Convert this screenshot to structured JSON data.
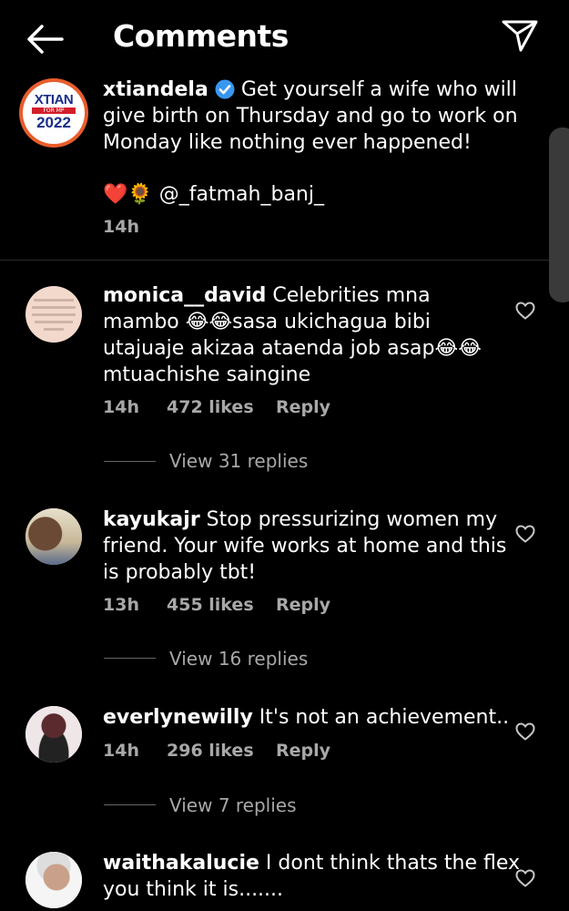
{
  "header": {
    "title": "Comments",
    "back_icon": "back-arrow-icon",
    "send_icon": "send-icon"
  },
  "caption": {
    "username": "xtiandela",
    "verified": true,
    "text_line1": "Get yourself a wife who will",
    "text_line2": "give birth on Thursday and go to work on",
    "text_line3": "Monday like nothing ever happened!",
    "emoji_line": "❤️🌻 @_fatmah_banj_",
    "time": "14h",
    "avatar_text_top": "XTIAN",
    "avatar_text_mid": "FOR MP",
    "avatar_text_bottom": "2022",
    "colors": {
      "ring": "#e85d2c",
      "blue": "#1a2f8a",
      "red": "#d21f2b",
      "verified": "#3897f0"
    }
  },
  "comments": [
    {
      "username": "monica__david",
      "line1": "Celebrities mna",
      "line2": "mambo 😂😂sasa ukichagua bibi",
      "line3": "utajuaje akizaa ataenda job asap😂😂",
      "line4": "mtuachishe saingine",
      "time": "14h",
      "likes": "472 likes",
      "reply": "Reply",
      "view_replies": "View 31 replies"
    },
    {
      "username": "kayukajr",
      "line1": "Stop pressurizing women my",
      "line2": "friend. Your wife works at home and this",
      "line3": "is probably tbt!",
      "time": "13h",
      "likes": "455 likes",
      "reply": "Reply",
      "view_replies": "View 16 replies"
    },
    {
      "username": "everlynewilly",
      "line1": "It's not an achievement..",
      "time": "14h",
      "likes": "296 likes",
      "reply": "Reply",
      "view_replies": "View 7 replies"
    },
    {
      "username": "waithakalucie",
      "line1": "I dont think thats the flex",
      "line2": "you think it is......."
    }
  ]
}
